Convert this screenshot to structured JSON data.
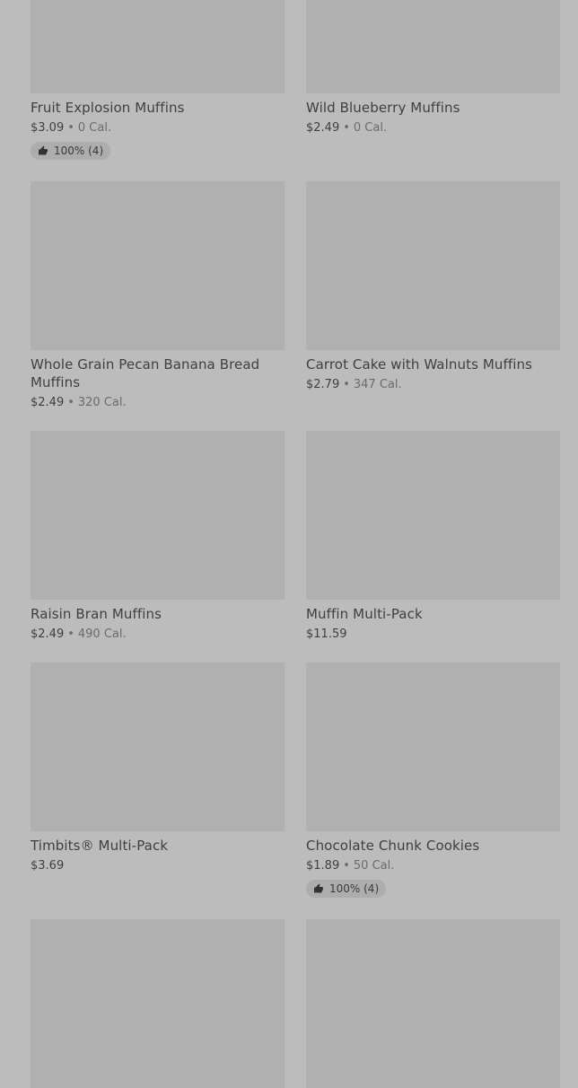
{
  "products": [
    {
      "name": "Fruit Explosion Muffins",
      "price": "$3.09",
      "calories": "0 Cal.",
      "rating": "100% (4)"
    },
    {
      "name": "Wild Blueberry Muffins",
      "price": "$2.49",
      "calories": "0 Cal.",
      "rating": null
    },
    {
      "name": "Whole Grain Pecan Banana Bread Muffins",
      "price": "$2.49",
      "calories": "320 Cal.",
      "rating": null
    },
    {
      "name": "Carrot Cake with Walnuts Muffins",
      "price": "$2.79",
      "calories": "347 Cal.",
      "rating": null
    },
    {
      "name": "Raisin Bran Muffins",
      "price": "$2.49",
      "calories": "490 Cal.",
      "rating": null
    },
    {
      "name": "Muffin Multi-Pack",
      "price": "$11.59",
      "calories": null,
      "rating": null
    },
    {
      "name": "Timbits® Multi-Pack",
      "price": "$3.69",
      "calories": null,
      "rating": null
    },
    {
      "name": "Chocolate Chunk Cookies",
      "price": "$1.89",
      "calories": "50 Cal.",
      "rating": "100% (4)"
    }
  ],
  "separator": "•",
  "colors": {
    "background": "#bcbcbc",
    "thumbnail": "#b0b0b0",
    "rating_pill": "#adadad"
  },
  "icons": {
    "rating": "thumbs-up-icon"
  }
}
